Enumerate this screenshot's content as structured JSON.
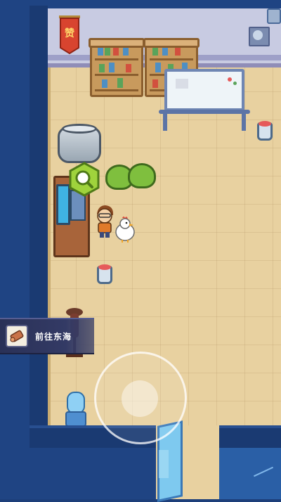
{
  "scene": {
    "banner_glyph": "赞",
    "banner_icon": "thumbs-up-banner-icon"
  },
  "interact": {
    "icon": "magnifier-icon",
    "color": "#9fd33c"
  },
  "location_prompt": {
    "label": "前往东海",
    "icon": "map-scroll-icon"
  },
  "joystick": {
    "icon": "joystick-icon"
  },
  "colors": {
    "floor": "#e8d1a0",
    "wall": "#1f4483",
    "accent_green": "#7fbf3e"
  }
}
